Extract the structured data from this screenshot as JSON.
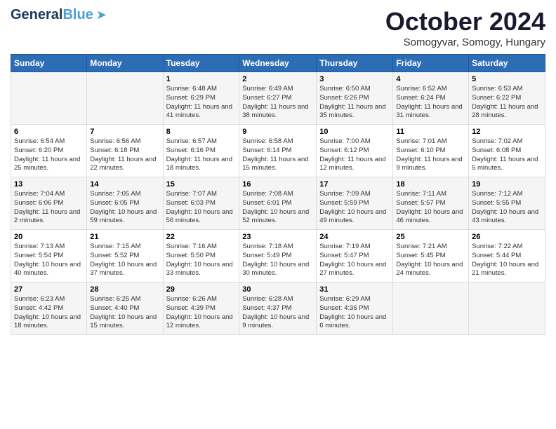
{
  "logo": {
    "part1": "General",
    "part2": "Blue"
  },
  "header": {
    "month": "October 2024",
    "location": "Somogyvar, Somogy, Hungary"
  },
  "days_of_week": [
    "Sunday",
    "Monday",
    "Tuesday",
    "Wednesday",
    "Thursday",
    "Friday",
    "Saturday"
  ],
  "weeks": [
    [
      {
        "day": "",
        "info": ""
      },
      {
        "day": "",
        "info": ""
      },
      {
        "day": "1",
        "info": "Sunrise: 6:48 AM\nSunset: 6:29 PM\nDaylight: 11 hours and 41 minutes."
      },
      {
        "day": "2",
        "info": "Sunrise: 6:49 AM\nSunset: 6:27 PM\nDaylight: 11 hours and 38 minutes."
      },
      {
        "day": "3",
        "info": "Sunrise: 6:50 AM\nSunset: 6:26 PM\nDaylight: 11 hours and 35 minutes."
      },
      {
        "day": "4",
        "info": "Sunrise: 6:52 AM\nSunset: 6:24 PM\nDaylight: 11 hours and 31 minutes."
      },
      {
        "day": "5",
        "info": "Sunrise: 6:53 AM\nSunset: 6:22 PM\nDaylight: 11 hours and 28 minutes."
      }
    ],
    [
      {
        "day": "6",
        "info": "Sunrise: 6:54 AM\nSunset: 6:20 PM\nDaylight: 11 hours and 25 minutes."
      },
      {
        "day": "7",
        "info": "Sunrise: 6:56 AM\nSunset: 6:18 PM\nDaylight: 11 hours and 22 minutes."
      },
      {
        "day": "8",
        "info": "Sunrise: 6:57 AM\nSunset: 6:16 PM\nDaylight: 11 hours and 18 minutes."
      },
      {
        "day": "9",
        "info": "Sunrise: 6:58 AM\nSunset: 6:14 PM\nDaylight: 11 hours and 15 minutes."
      },
      {
        "day": "10",
        "info": "Sunrise: 7:00 AM\nSunset: 6:12 PM\nDaylight: 11 hours and 12 minutes."
      },
      {
        "day": "11",
        "info": "Sunrise: 7:01 AM\nSunset: 6:10 PM\nDaylight: 11 hours and 9 minutes."
      },
      {
        "day": "12",
        "info": "Sunrise: 7:02 AM\nSunset: 6:08 PM\nDaylight: 11 hours and 5 minutes."
      }
    ],
    [
      {
        "day": "13",
        "info": "Sunrise: 7:04 AM\nSunset: 6:06 PM\nDaylight: 11 hours and 2 minutes."
      },
      {
        "day": "14",
        "info": "Sunrise: 7:05 AM\nSunset: 6:05 PM\nDaylight: 10 hours and 59 minutes."
      },
      {
        "day": "15",
        "info": "Sunrise: 7:07 AM\nSunset: 6:03 PM\nDaylight: 10 hours and 56 minutes."
      },
      {
        "day": "16",
        "info": "Sunrise: 7:08 AM\nSunset: 6:01 PM\nDaylight: 10 hours and 52 minutes."
      },
      {
        "day": "17",
        "info": "Sunrise: 7:09 AM\nSunset: 5:59 PM\nDaylight: 10 hours and 49 minutes."
      },
      {
        "day": "18",
        "info": "Sunrise: 7:11 AM\nSunset: 5:57 PM\nDaylight: 10 hours and 46 minutes."
      },
      {
        "day": "19",
        "info": "Sunrise: 7:12 AM\nSunset: 5:55 PM\nDaylight: 10 hours and 43 minutes."
      }
    ],
    [
      {
        "day": "20",
        "info": "Sunrise: 7:13 AM\nSunset: 5:54 PM\nDaylight: 10 hours and 40 minutes."
      },
      {
        "day": "21",
        "info": "Sunrise: 7:15 AM\nSunset: 5:52 PM\nDaylight: 10 hours and 37 minutes."
      },
      {
        "day": "22",
        "info": "Sunrise: 7:16 AM\nSunset: 5:50 PM\nDaylight: 10 hours and 33 minutes."
      },
      {
        "day": "23",
        "info": "Sunrise: 7:18 AM\nSunset: 5:49 PM\nDaylight: 10 hours and 30 minutes."
      },
      {
        "day": "24",
        "info": "Sunrise: 7:19 AM\nSunset: 5:47 PM\nDaylight: 10 hours and 27 minutes."
      },
      {
        "day": "25",
        "info": "Sunrise: 7:21 AM\nSunset: 5:45 PM\nDaylight: 10 hours and 24 minutes."
      },
      {
        "day": "26",
        "info": "Sunrise: 7:22 AM\nSunset: 5:44 PM\nDaylight: 10 hours and 21 minutes."
      }
    ],
    [
      {
        "day": "27",
        "info": "Sunrise: 6:23 AM\nSunset: 4:42 PM\nDaylight: 10 hours and 18 minutes."
      },
      {
        "day": "28",
        "info": "Sunrise: 6:25 AM\nSunset: 4:40 PM\nDaylight: 10 hours and 15 minutes."
      },
      {
        "day": "29",
        "info": "Sunrise: 6:26 AM\nSunset: 4:39 PM\nDaylight: 10 hours and 12 minutes."
      },
      {
        "day": "30",
        "info": "Sunrise: 6:28 AM\nSunset: 4:37 PM\nDaylight: 10 hours and 9 minutes."
      },
      {
        "day": "31",
        "info": "Sunrise: 6:29 AM\nSunset: 4:36 PM\nDaylight: 10 hours and 6 minutes."
      },
      {
        "day": "",
        "info": ""
      },
      {
        "day": "",
        "info": ""
      }
    ]
  ]
}
